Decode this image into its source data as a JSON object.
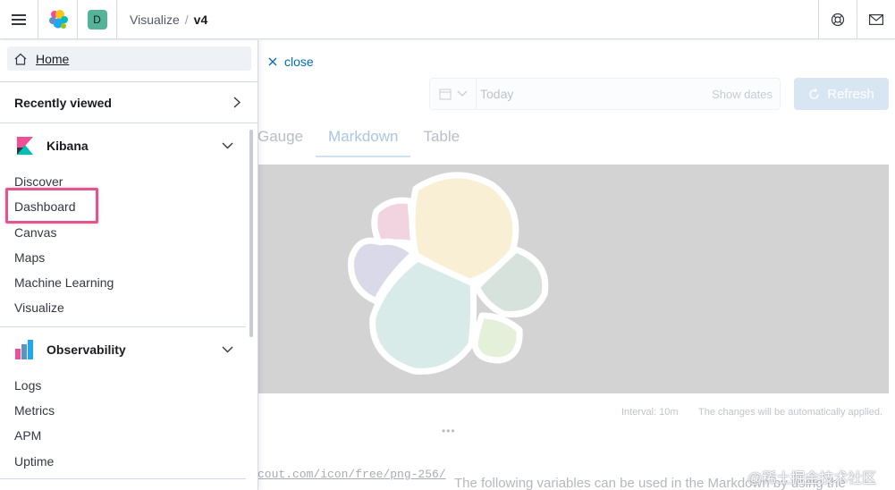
{
  "header": {
    "space_initial": "D",
    "breadcrumbs": [
      {
        "label": "Visualize"
      },
      {
        "label": "v4"
      }
    ],
    "separator": "/"
  },
  "nav": {
    "home_label": "Home",
    "recently_viewed_label": "Recently viewed",
    "groups": [
      {
        "title": "Kibana",
        "items": [
          "Discover",
          "Dashboard",
          "Canvas",
          "Maps",
          "Machine Learning",
          "Visualize"
        ]
      },
      {
        "title": "Observability",
        "items": [
          "Logs",
          "Metrics",
          "APM",
          "Uptime"
        ]
      }
    ],
    "highlighted_item": "Dashboard"
  },
  "app": {
    "close_label": "close",
    "date_placeholder": "Today",
    "show_dates_label": "Show dates",
    "refresh_label": "Refresh",
    "tabs": [
      "Gauge",
      "Markdown",
      "Table"
    ],
    "active_tab": "Markdown",
    "interval_label": "Interval: 10m",
    "auto_apply_text": "The changes will be automatically applied.",
    "dots": "•••",
    "code_text": "cout.com/icon/free/png-256/",
    "help_text": "The following variables can be used in the Markdown by using the",
    "watermark": "@稀土掘金技术社区"
  },
  "colors": {
    "accent_link": "#006bb8",
    "space_avatar": "#54b399",
    "highlight_box": "#e0568f",
    "preview_bg": "#d3d3d3"
  }
}
